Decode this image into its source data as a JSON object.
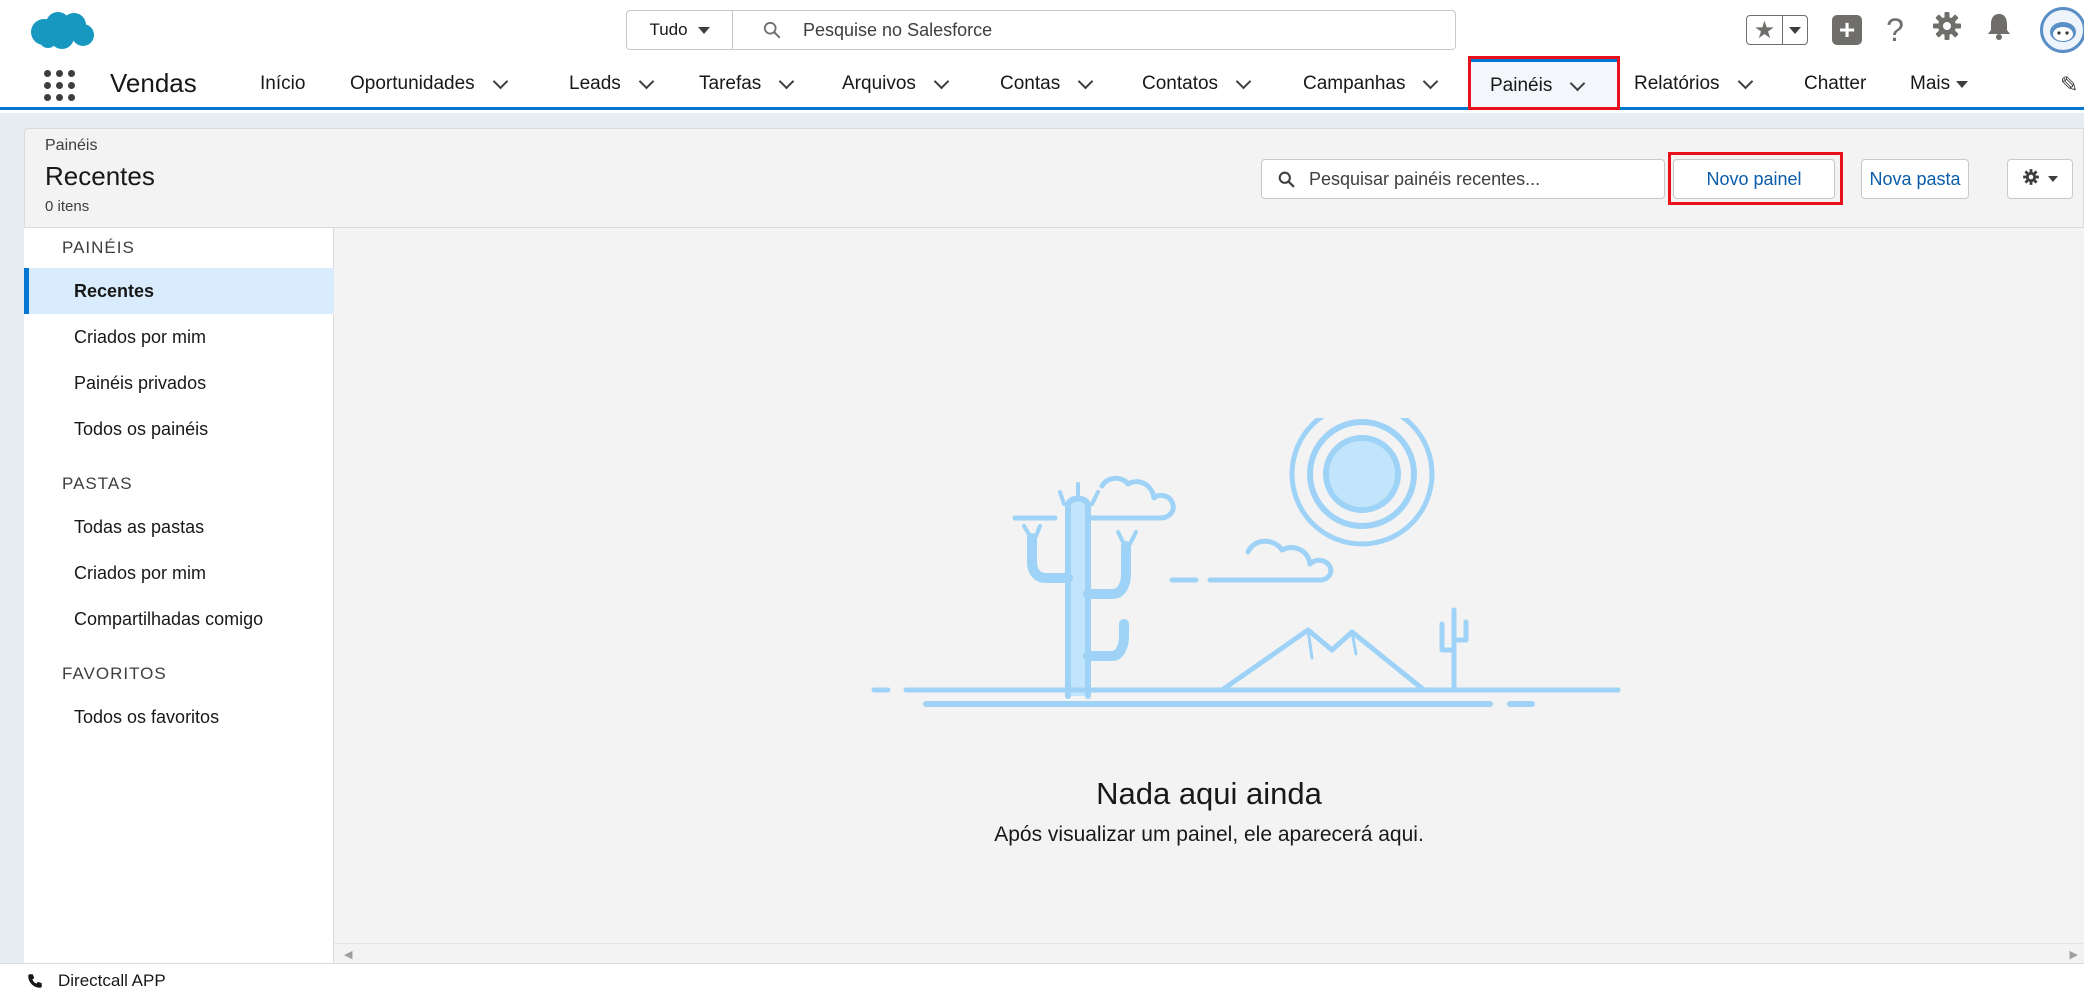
{
  "header": {
    "search_scope": "Tudo",
    "search_placeholder": "Pesquise no Salesforce",
    "icons": [
      "salesforce-cloud-logo",
      "star-icon",
      "plus-icon",
      "help-icon",
      "gear-icon",
      "bell-icon",
      "avatar"
    ]
  },
  "nav": {
    "app_name": "Vendas",
    "items": [
      {
        "label": "Início"
      },
      {
        "label": "Oportunidades"
      },
      {
        "label": "Leads"
      },
      {
        "label": "Tarefas"
      },
      {
        "label": "Arquivos"
      },
      {
        "label": "Contas"
      },
      {
        "label": "Contatos"
      },
      {
        "label": "Campanhas"
      },
      {
        "label": "Painéis"
      },
      {
        "label": "Relatórios"
      },
      {
        "label": "Chatter"
      },
      {
        "label": "Mais"
      }
    ],
    "active": "Painéis"
  },
  "list_header": {
    "breadcrumb": "Painéis",
    "title": "Recentes",
    "count": "0 itens",
    "search_placeholder": "Pesquisar painéis recentes...",
    "new_dashboard": "Novo painel",
    "new_folder": "Nova pasta"
  },
  "sidebar": {
    "sections": [
      {
        "title": "PAINÉIS",
        "items": [
          "Recentes",
          "Criados por mim",
          "Painéis privados",
          "Todos os painéis"
        ]
      },
      {
        "title": "PASTAS",
        "items": [
          "Todas as pastas",
          "Criados por mim",
          "Compartilhadas comigo"
        ]
      },
      {
        "title": "FAVORITOS",
        "items": [
          "Todos os favoritos"
        ]
      }
    ],
    "selected": "Recentes"
  },
  "empty_state": {
    "title": "Nada aqui ainda",
    "subtitle": "Após visualizar um painel, ele aparecerá aqui."
  },
  "utility": {
    "label": "Directcall APP"
  },
  "colors": {
    "brand": "#0176d3",
    "highlight": "#e8111b",
    "illustration": "#9ed3f7"
  }
}
